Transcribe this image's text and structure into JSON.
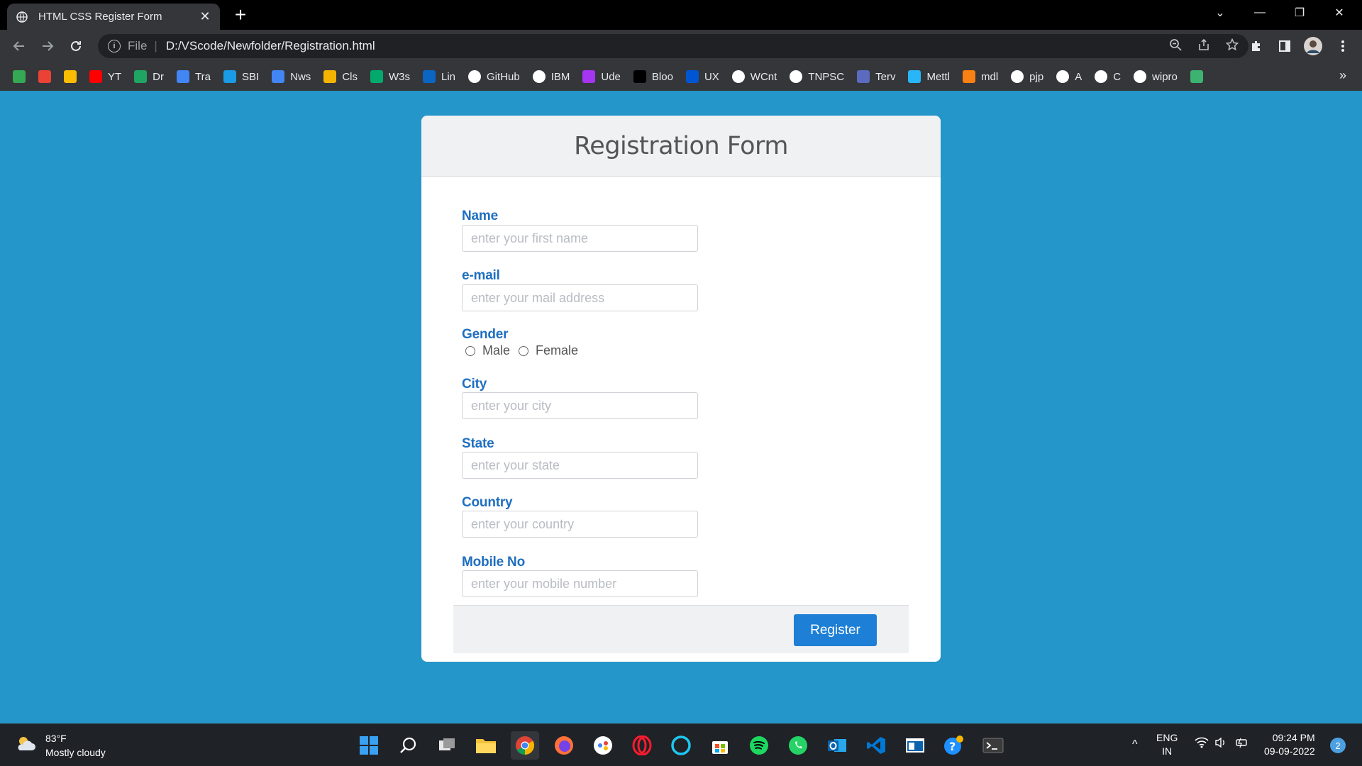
{
  "browser": {
    "tab_title": "HTML CSS Register Form",
    "url_scheme": "File",
    "url": "D:/VScode/Newfolder/Registration.html",
    "bookmarks": [
      {
        "label": "",
        "icon": "maps-icon",
        "color": "#34a853"
      },
      {
        "label": "",
        "icon": "gmail-icon",
        "color": "#ea4335"
      },
      {
        "label": "",
        "icon": "store-icon",
        "color": "#fbbc04"
      },
      {
        "label": "YT",
        "icon": "youtube-icon",
        "color": "#ff0000"
      },
      {
        "label": "Dr",
        "icon": "drive-icon",
        "color": "#1fa463"
      },
      {
        "label": "Tra",
        "icon": "translate-icon",
        "color": "#4285f4"
      },
      {
        "label": "SBI",
        "icon": "sbi-icon",
        "color": "#1a9be6"
      },
      {
        "label": "Nws",
        "icon": "news-icon",
        "color": "#4285f4"
      },
      {
        "label": "Cls",
        "icon": "classroom-icon",
        "color": "#f5b400"
      },
      {
        "label": "W3s",
        "icon": "w3schools-icon",
        "color": "#04aa6d"
      },
      {
        "label": "Lin",
        "icon": "linkedin-icon",
        "color": "#0a66c2"
      },
      {
        "label": "GitHub",
        "icon": "github-icon",
        "color": "#ffffff"
      },
      {
        "label": "IBM",
        "icon": "globe-icon",
        "color": "#ffffff"
      },
      {
        "label": "Ude",
        "icon": "udemy-icon",
        "color": "#a435f0"
      },
      {
        "label": "Bloo",
        "icon": "bloomberg-icon",
        "color": "#000000"
      },
      {
        "label": "UX",
        "icon": "coursera-icon",
        "color": "#0056d2"
      },
      {
        "label": "WCnt",
        "icon": "globe-icon",
        "color": "#ffffff"
      },
      {
        "label": "TNPSC",
        "icon": "globe-icon",
        "color": "#ffffff"
      },
      {
        "label": "Terv",
        "icon": "terv-icon",
        "color": "#5c6bc0"
      },
      {
        "label": "Mettl",
        "icon": "mettl-icon",
        "color": "#29b6f6"
      },
      {
        "label": "mdl",
        "icon": "moodle-icon",
        "color": "#f98012"
      },
      {
        "label": "pjp",
        "icon": "github-icon",
        "color": "#ffffff"
      },
      {
        "label": "A",
        "icon": "globe-icon",
        "color": "#ffffff"
      },
      {
        "label": "C",
        "icon": "globe-icon",
        "color": "#ffffff"
      },
      {
        "label": "wipro",
        "icon": "globe-icon",
        "color": "#ffffff"
      },
      {
        "label": "",
        "icon": "wipro-logo-icon",
        "color": "#3cb371"
      }
    ],
    "bookmarks_more": "»"
  },
  "form": {
    "title": "Registration Form",
    "name_label": "Name",
    "name_placeholder": "enter your first name",
    "email_label": "e-mail",
    "email_placeholder": "enter your mail address",
    "gender_label": "Gender",
    "gender_male": "Male",
    "gender_female": "Female",
    "city_label": "City",
    "city_placeholder": "enter your city",
    "state_label": "State",
    "state_placeholder": "enter your state",
    "country_label": "Country",
    "country_placeholder": "enter your country",
    "mobile_label": "Mobile No",
    "mobile_placeholder": "enter your mobile number",
    "submit_label": "Register"
  },
  "taskbar": {
    "weather_temp": "83°F",
    "weather_desc": "Mostly cloudy",
    "lang_top": "ENG",
    "lang_bottom": "IN",
    "time": "09:24 PM",
    "date": "09-09-2022",
    "notification_count": "2"
  },
  "colors": {
    "page_bg": "#2596c9",
    "label": "#1f6fc0",
    "button": "#1d7fd6"
  }
}
